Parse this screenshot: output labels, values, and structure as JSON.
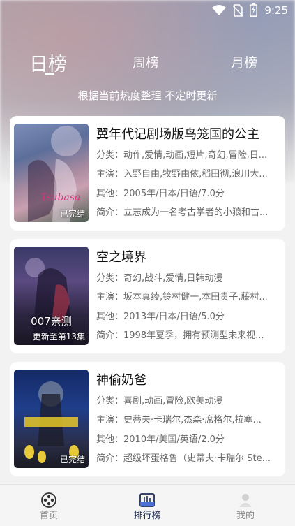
{
  "status_bar": {
    "time": "9:25"
  },
  "tabs": [
    {
      "label": "日榜",
      "active": true
    },
    {
      "label": "周榜",
      "active": false
    },
    {
      "label": "月榜",
      "active": false
    }
  ],
  "subtitle": "根据当前热度整理 不定时更新",
  "items": [
    {
      "title": "翼年代记剧场版鸟笼国的公主",
      "category": "分类：动作,爱情,动画,短片,奇幻,冒险,日...",
      "cast": "主演：入野自由,牧野由依,稻田彻,浪川大...",
      "other": "其他：2005年/日本/日语/7.0分",
      "intro": "简介：立志成为一名考古学者的小狼和古...",
      "badge": "已完结",
      "overlay": ""
    },
    {
      "title": "空之境界",
      "category": "分类：奇幻,战斗,爱情,日韩动漫",
      "cast": "主演：坂本真绫,铃村健一,本田贵子,藤村...",
      "other": "其他：2013年/日本/日语/5.0分",
      "intro": "简介：1998年夏季，拥有预测型未来视...",
      "badge": "更新至第13集",
      "overlay": "007亲测"
    },
    {
      "title": "神偷奶爸",
      "category": "分类：喜剧,动画,冒险,欧美动漫",
      "cast": "主演：史蒂夫·卡瑞尔,杰森·席格尔,拉塞...",
      "other": "其他：2010年/美国/英语/2.0分",
      "intro": "简介：超级坏蛋格鲁（史蒂夫·卡瑞尔 Ste...",
      "badge": "已完结",
      "overlay": ""
    }
  ],
  "bottom_nav": [
    {
      "label": "首页",
      "icon": "film-reel-icon",
      "active": false
    },
    {
      "label": "排行榜",
      "icon": "ranking-chart-icon",
      "active": true
    },
    {
      "label": "我的",
      "icon": "profile-icon",
      "active": false
    }
  ],
  "colors": {
    "nav_active": "#1e2e55",
    "nav_inactive": "#8a8a8a",
    "text_secondary": "#666666"
  }
}
